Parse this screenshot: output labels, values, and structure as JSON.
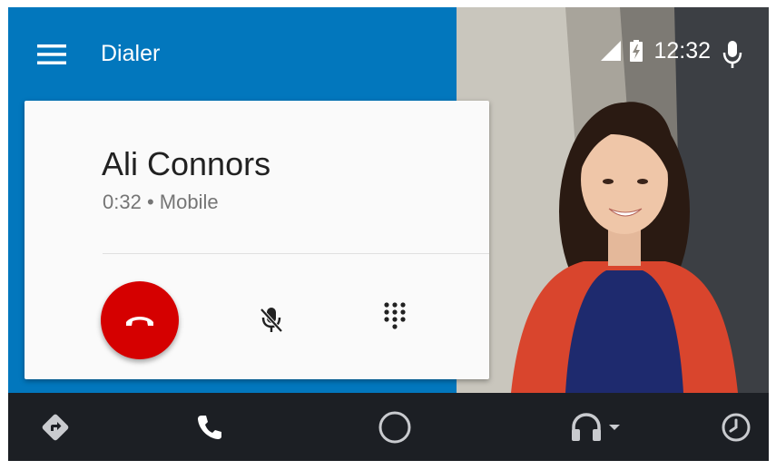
{
  "header": {
    "title": "Dialer",
    "menu_icon": "hamburger-menu-icon"
  },
  "status_bar": {
    "time": "12:32",
    "signal_icon": "cell-signal-icon",
    "battery_icon": "battery-charging-icon",
    "voice_icon": "microphone-icon"
  },
  "call": {
    "contact_name": "Ali Connors",
    "duration": "0:32",
    "separator": "•",
    "number_type": "Mobile",
    "actions": {
      "end_call_icon": "end-call-icon",
      "mute_icon": "mic-off-icon",
      "dialpad_icon": "dialpad-icon"
    }
  },
  "bottom_nav": {
    "items": [
      {
        "icon": "navigation-icon"
      },
      {
        "icon": "phone-icon"
      },
      {
        "icon": "home-circle-icon"
      },
      {
        "icon": "headphones-icon"
      },
      {
        "icon": "overview-icon"
      }
    ]
  },
  "colors": {
    "primary": "#0277bd",
    "end_call": "#d50000",
    "nav_bar": "#1c1f24",
    "card": "#fafafa"
  }
}
